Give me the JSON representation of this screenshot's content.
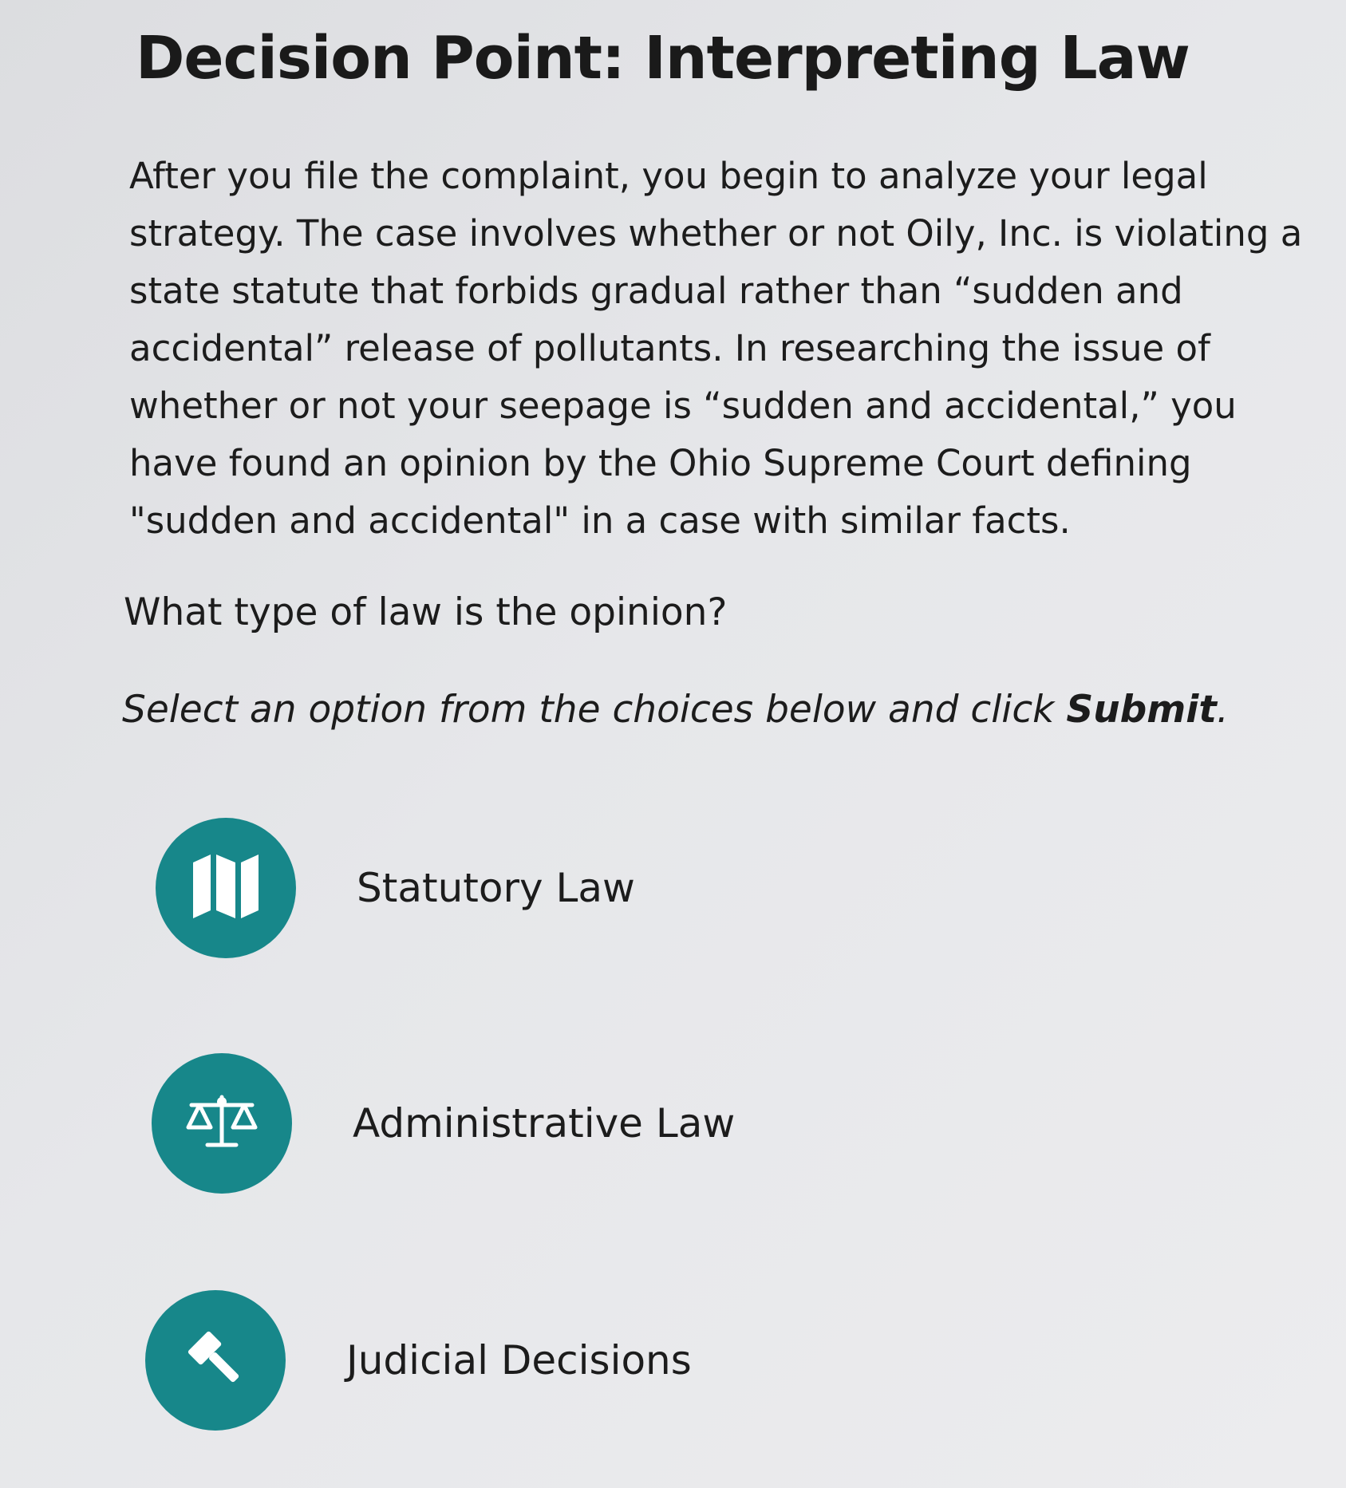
{
  "title": "Decision Point: Interpreting Law",
  "intro_text": "After you file the complaint, you begin to analyze your legal strategy. The case involves whether or not Oily, Inc. is violating a state statute that forbids gradual rather than “sudden and accidental” release of pollutants. In researching the issue of whether or not your seepage is “sudden and accidental,” you have found an opinion by the Ohio Supreme Court defining \"sudden and accidental\" in a case with similar facts.",
  "question": "What type of law is the opinion?",
  "instruction": {
    "prefix": "Select an option from the choices below and click ",
    "emphasis": "Submit",
    "suffix": "."
  },
  "colors": {
    "accent": "#17878a",
    "icon": "#ffffff"
  },
  "options": [
    {
      "label": "Statutory Law",
      "icon": "map-icon"
    },
    {
      "label": "Administrative Law",
      "icon": "scales-icon"
    },
    {
      "label": "Judicial Decisions",
      "icon": "gavel-icon"
    }
  ]
}
